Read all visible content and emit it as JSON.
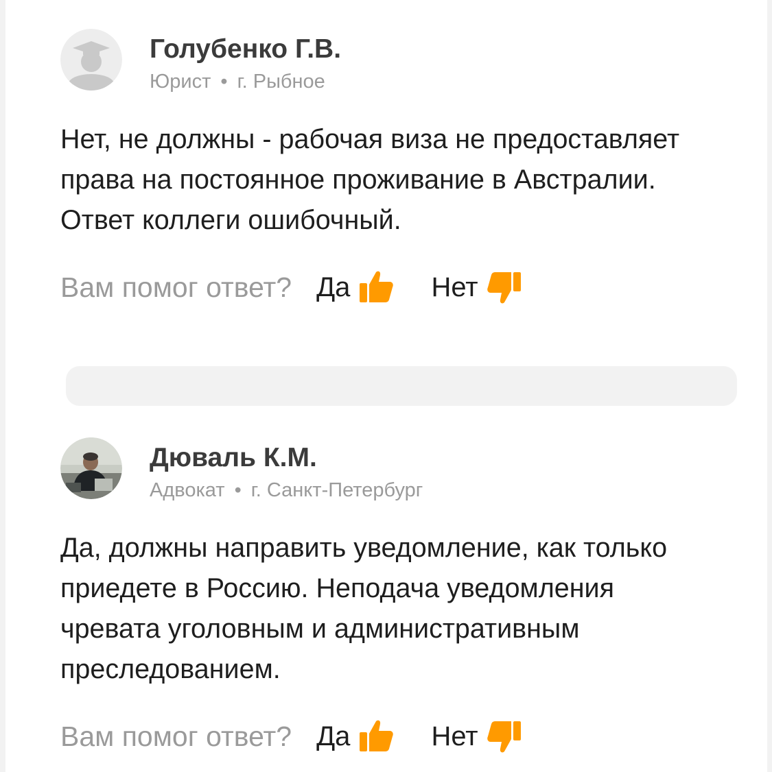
{
  "answers": [
    {
      "author": "Голубенко Г.В.",
      "role": "Юрист",
      "separator": "•",
      "city": "г. Рыбное",
      "text": "Нет, не должны - рабочая виза не предоставляет права на постоянное проживание в Австралии. Ответ коллеги ошибочный.",
      "feedback": {
        "question": "Вам помог ответ?",
        "yes_label": "Да",
        "no_label": "Нет"
      }
    },
    {
      "author": "Дюваль К.М.",
      "role": "Адвокат",
      "separator": "•",
      "city": "г. Санкт-Петербург",
      "text": "Да, должны направить уведомление, как только приедете в Россию. Неподача уведомления чревата уголовным и административным преследованием.",
      "feedback": {
        "question": "Вам помог ответ?",
        "yes_label": "Да",
        "no_label": "Нет"
      }
    }
  ],
  "icons": {
    "thumb_up": "thumbs-up-icon",
    "thumb_down": "thumbs-down-icon",
    "avatar_placeholder": "graduate-avatar-icon"
  },
  "colors": {
    "accent_orange": "#ff9a00",
    "name_text": "#3b3b3b",
    "meta_text": "#9a9a9a",
    "body_text": "#1e1e1e",
    "page_bg": "#f2f2f2"
  }
}
